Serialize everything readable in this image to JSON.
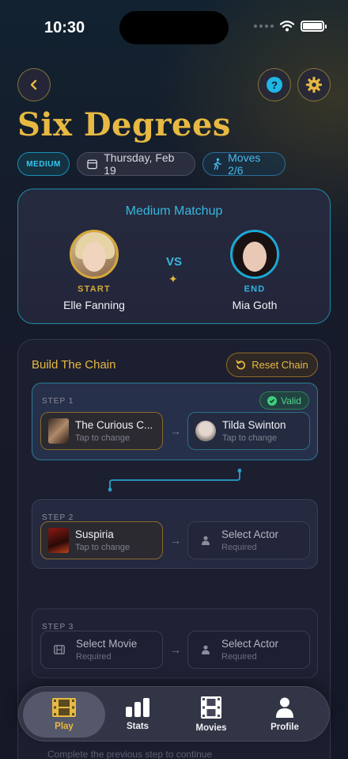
{
  "status_bar": {
    "time": "10:30",
    "battery_level": 1.0
  },
  "header": {
    "title": "Six Degrees",
    "difficulty_badge": "MEDIUM",
    "date": "Thursday, Feb 19",
    "moves": "Moves 2/6"
  },
  "matchup": {
    "title": "Medium Matchup",
    "start_label": "START",
    "start_actor": "Elle Fanning",
    "vs": "VS",
    "end_label": "END",
    "end_actor": "Mia Goth"
  },
  "chain": {
    "title": "Build The Chain",
    "reset_label": "Reset Chain",
    "steps": [
      {
        "label": "STEP 1",
        "badge": "Valid",
        "movie": {
          "title": "The Curious C...",
          "sub": "Tap to change"
        },
        "actor": {
          "name": "Tilda Swinton",
          "sub": "Tap to change"
        }
      },
      {
        "label": "STEP 2",
        "movie": {
          "title": "Suspiria",
          "sub": "Tap to change"
        },
        "actor": {
          "name": "Select Actor",
          "sub": "Required"
        }
      },
      {
        "label": "STEP 3",
        "movie": {
          "title": "Select Movie",
          "sub": "Required"
        },
        "actor": {
          "name": "Select Actor",
          "sub": "Required"
        }
      }
    ],
    "hint": "Complete the previous step to continue"
  },
  "tabs": [
    {
      "label": "Play",
      "icon": "film-icon",
      "active": true
    },
    {
      "label": "Stats",
      "icon": "bar-chart-icon"
    },
    {
      "label": "Movies",
      "icon": "film-strip-icon"
    },
    {
      "label": "Profile",
      "icon": "person-icon"
    }
  ],
  "colors": {
    "accent_gold": "#e7b942",
    "accent_cyan": "#35b8df",
    "valid_green": "#52d28e",
    "background": "#151826"
  }
}
